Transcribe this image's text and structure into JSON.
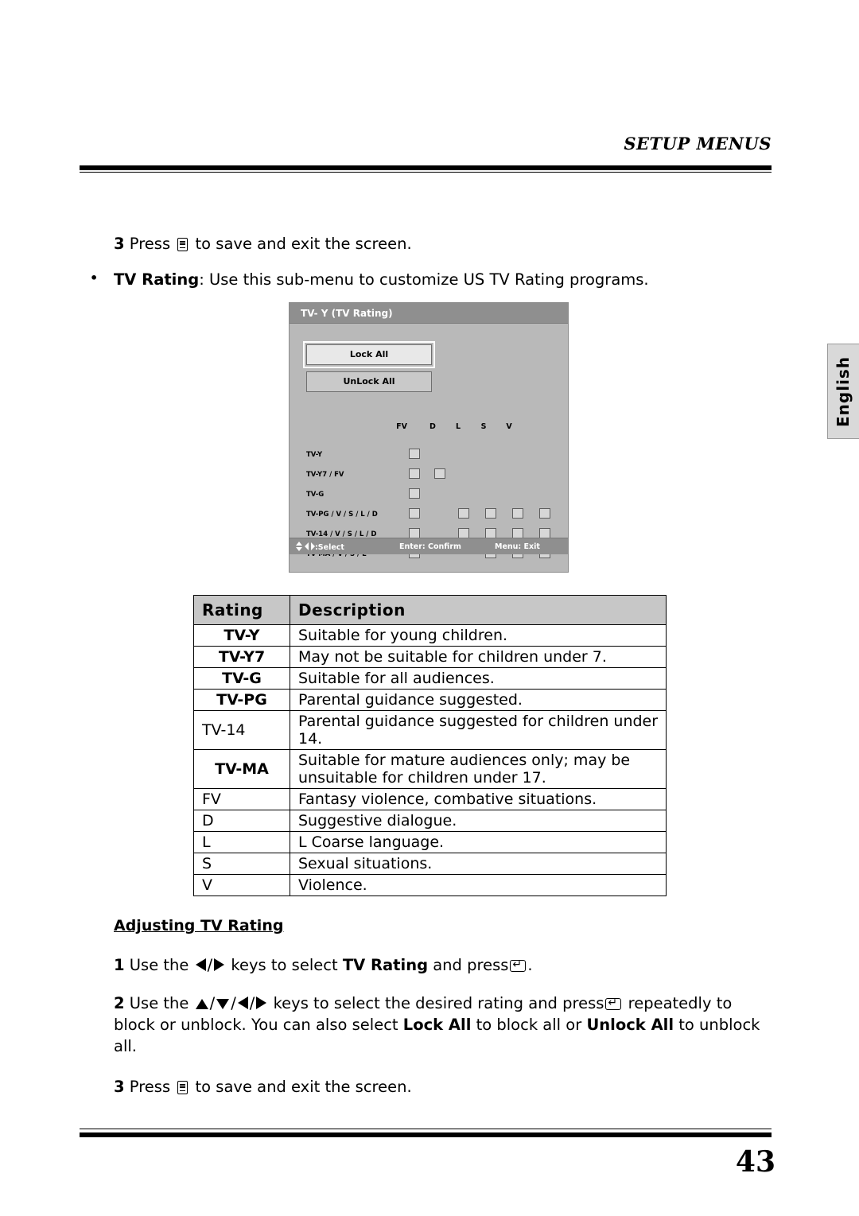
{
  "header": {
    "title": "SETUP MENUS"
  },
  "language_tab": {
    "label": "English"
  },
  "top_steps": [
    {
      "num": "3",
      "before": "Press",
      "after": "to save and exit the screen.",
      "icon": "menu-icon"
    }
  ],
  "bullet": {
    "marker": "•",
    "bold_label": "TV Rating",
    "text": ": Use this sub-menu to customize US TV Rating programs."
  },
  "osd": {
    "title": "TV- Y (TV Rating)",
    "buttons": [
      {
        "label": "Lock All",
        "name": "lock-all-button",
        "selected": true
      },
      {
        "label": "UnLock All",
        "name": "unlock-all-button",
        "selected": false
      }
    ],
    "column_headers": [
      "FV",
      "D",
      "L",
      "S",
      "V"
    ],
    "rows": [
      {
        "label": "TV-Y",
        "boxes": [
          1,
          0,
          0,
          0,
          0
        ]
      },
      {
        "label": "TV-Y7 / FV",
        "boxes": [
          1,
          1,
          0,
          0,
          0
        ]
      },
      {
        "label": "TV-G",
        "boxes": [
          1,
          0,
          0,
          0,
          0
        ]
      },
      {
        "label": "TV-PG / V / S / L / D",
        "boxes": [
          1,
          0,
          1,
          1,
          1,
          1
        ]
      },
      {
        "label": "TV-14 / V / S / L / D",
        "boxes": [
          1,
          0,
          1,
          1,
          1,
          1
        ]
      },
      {
        "label": "TV-MA / V / S / L",
        "boxes": [
          1,
          0,
          0,
          1,
          1,
          1
        ]
      }
    ],
    "footer": {
      "select": ":Select",
      "enter": "Enter: Confirm",
      "exit": "Menu: Exit"
    }
  },
  "table": {
    "headers": [
      "Rating",
      "Description"
    ],
    "rows": [
      {
        "code": "TV-Y",
        "bold": true,
        "desc": "Suitable for young children."
      },
      {
        "code": "TV-Y7",
        "bold": true,
        "desc": "May not be suitable for children under 7."
      },
      {
        "code": "TV-G",
        "bold": true,
        "desc": "Suitable for all audiences."
      },
      {
        "code": "TV-PG",
        "bold": true,
        "desc": "Parental guidance suggested."
      },
      {
        "code": "TV-14",
        "bold": false,
        "desc": "Parental guidance suggested for children under 14."
      },
      {
        "code": "TV-MA",
        "bold": true,
        "desc": "Suitable for mature audiences only; may be unsuitable for children under 17."
      },
      {
        "code": "FV",
        "bold": false,
        "desc": "Fantasy violence, combative situations."
      },
      {
        "code": "D",
        "bold": false,
        "desc": "Suggestive dialogue."
      },
      {
        "code": "L",
        "bold": false,
        "desc": "L Coarse language."
      },
      {
        "code": "S",
        "bold": false,
        "desc": "Sexual situations."
      },
      {
        "code": "V",
        "bold": false,
        "desc": "Violence."
      }
    ]
  },
  "subsection": {
    "heading": "Adjusting TV Rating"
  },
  "steps": [
    {
      "num": "1",
      "part1": "Use the",
      "part2": "keys to select",
      "bold1": "TV Rating",
      "part3": "and press",
      "part4": "."
    },
    {
      "num": "2",
      "part1": "Use the",
      "part2": "keys to select the desired rating and press",
      "part3": "repeatedly to block or unblock. You can also select",
      "bold1": "Lock All",
      "part4": "to block all or",
      "bold2": "Unlock All",
      "part5": "to unblock all."
    },
    {
      "num": "3",
      "part1": "Press",
      "part2": "to save and exit the screen."
    }
  ],
  "page_number": "43"
}
